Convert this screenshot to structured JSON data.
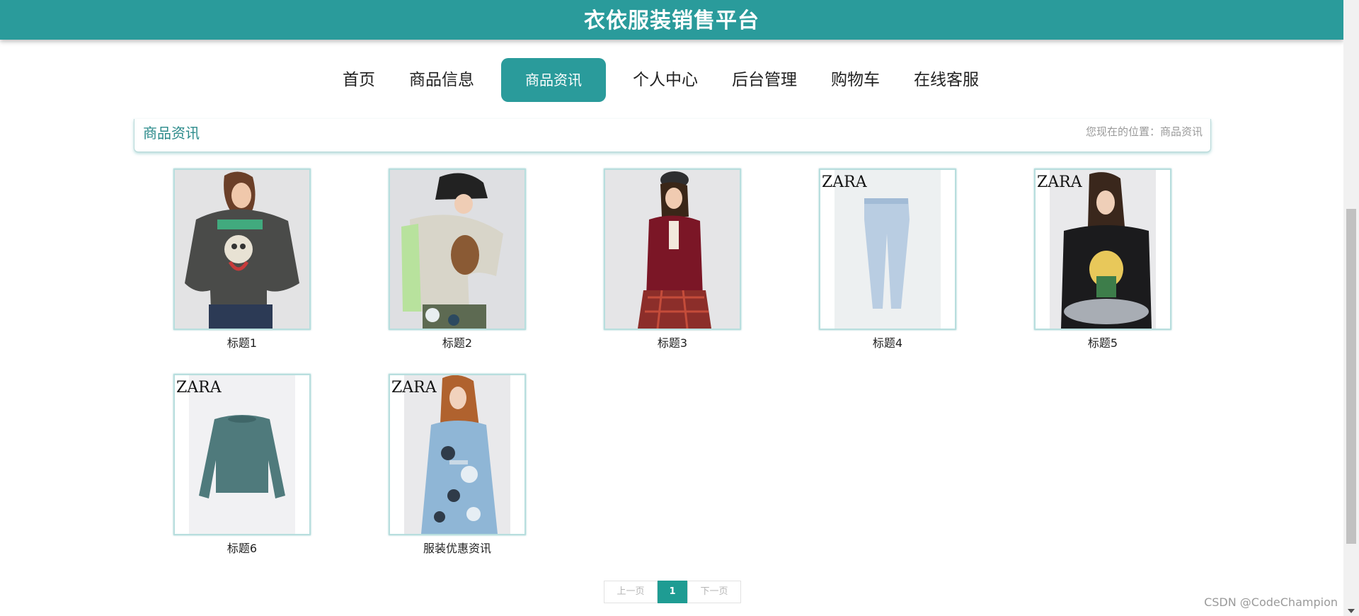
{
  "header": {
    "site_title": "衣依服装销售平台",
    "bar_color": "#2a9b9b"
  },
  "nav": {
    "items": [
      {
        "label": "首页",
        "active": false
      },
      {
        "label": "商品信息",
        "active": false
      },
      {
        "label": "商品资讯",
        "active": true
      },
      {
        "label": "个人中心",
        "active": false
      },
      {
        "label": "后台管理",
        "active": false
      },
      {
        "label": "购物车",
        "active": false
      },
      {
        "label": "在线客服",
        "active": false
      }
    ]
  },
  "section": {
    "title": "商品资讯",
    "breadcrumb": "您现在的位置：商品资讯"
  },
  "products": [
    {
      "caption": "标题1",
      "image": "model-grey-cartoon-sweatshirt"
    },
    {
      "caption": "标题2",
      "image": "model-bucket-hat-beige-sweater"
    },
    {
      "caption": "标题3",
      "image": "model-burgundy-cardigan-plaid-skirt"
    },
    {
      "caption": "标题4",
      "image": "light-blue-jeans"
    },
    {
      "caption": "标题5",
      "image": "model-black-tshirt-little-prince"
    },
    {
      "caption": "标题6",
      "image": "teal-cropped-sweatshirt"
    },
    {
      "caption": "服装优惠资讯",
      "image": "model-floral-blue-dress"
    }
  ],
  "brand_mark": "ZARA",
  "pagination": {
    "prev": "上一页",
    "current": "1",
    "next": "下一页"
  },
  "watermark": "CSDN @CodeChampion",
  "colors": {
    "accent": "#2a9b9b",
    "pager_active": "#1e9c93"
  }
}
